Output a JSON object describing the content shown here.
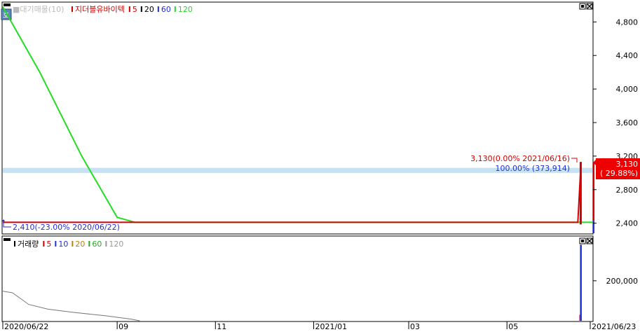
{
  "colors": {
    "price_line": "#d40000",
    "ma5": "#d40000",
    "ma20": "#000000",
    "ma60": "#1f2fd6",
    "ma120": "#22dd22",
    "band": "#bcdcf0",
    "volume_bar": "#1f2fd6",
    "volume_ma": "#777777",
    "ma20_vol": "#c08000",
    "label_blue": "#1f2fd6",
    "axis": "#000000"
  },
  "top_panel": {
    "icon_label": "호",
    "legend_faded": "■대기매물(10)",
    "legend_name": "지더블유바이텍",
    "legend_items": [
      "5",
      "20",
      "60",
      "120"
    ]
  },
  "annotations": {
    "last_price_tag": "3,130(0.00% 2021/06/16)",
    "band_label": "100.00% (373,914)",
    "low_tag": "2,410(-23.00% 2020/06/22)",
    "price_box_value": "3,130",
    "price_box_change": "( 29.88%)"
  },
  "bottom_panel": {
    "legend_name": "거래량",
    "legend_items": [
      "5",
      "10",
      "20",
      "60",
      "120"
    ]
  },
  "x_tick_labels": [
    "2020/06/22",
    "09",
    "11",
    "2021/01",
    "03",
    "05",
    "2021/06/23"
  ],
  "chart_data": [
    {
      "type": "line",
      "title": "지더블유바이텍",
      "y_ticks": [
        2400,
        2800,
        3200,
        3600,
        4000,
        4400,
        4800
      ],
      "y_tick_labels": [
        "2,400",
        "2,800",
        "3,200",
        "3,600",
        "4,000",
        "4,400",
        "4,800"
      ],
      "ylim": [
        2280,
        5020
      ],
      "x_range": [
        "2020/06/22",
        "2021/06/23"
      ],
      "series": [
        {
          "name": "120",
          "points": [
            [
              "2020/06/22",
              4980
            ],
            [
              "2020/07/15",
              4200
            ],
            [
              "2020/08/10",
              3200
            ],
            [
              "2020/09/01",
              2470
            ],
            [
              "2020/09/12",
              2410
            ],
            [
              "2021/06/23",
              2410
            ]
          ]
        },
        {
          "name": "5",
          "points": [
            [
              "2020/06/22",
              2410
            ],
            [
              "2021/06/14",
              2410
            ],
            [
              "2021/06/16",
              3130
            ]
          ]
        }
      ],
      "band": {
        "y_from": 3000,
        "y_to": 3060,
        "label": "100.00% (373,914)"
      },
      "current_price": 3130,
      "low_price": 2410
    },
    {
      "type": "bar",
      "title": "거래량",
      "y_ticks": [
        200000
      ],
      "y_tick_labels": [
        "200,000"
      ],
      "ylim": [
        0,
        420000
      ],
      "bars": [
        [
          "2021/06/16",
          380000
        ]
      ],
      "series": [
        {
          "name": "120",
          "points": [
            [
              "2020/06/22",
              148000
            ],
            [
              "2020/06/28",
              140000
            ],
            [
              "2020/07/08",
              82000
            ],
            [
              "2020/07/20",
              58000
            ],
            [
              "2020/08/05",
              42000
            ],
            [
              "2020/08/25",
              25000
            ],
            [
              "2020/09/10",
              8000
            ],
            [
              "2020/09/15",
              0
            ]
          ]
        }
      ]
    }
  ]
}
